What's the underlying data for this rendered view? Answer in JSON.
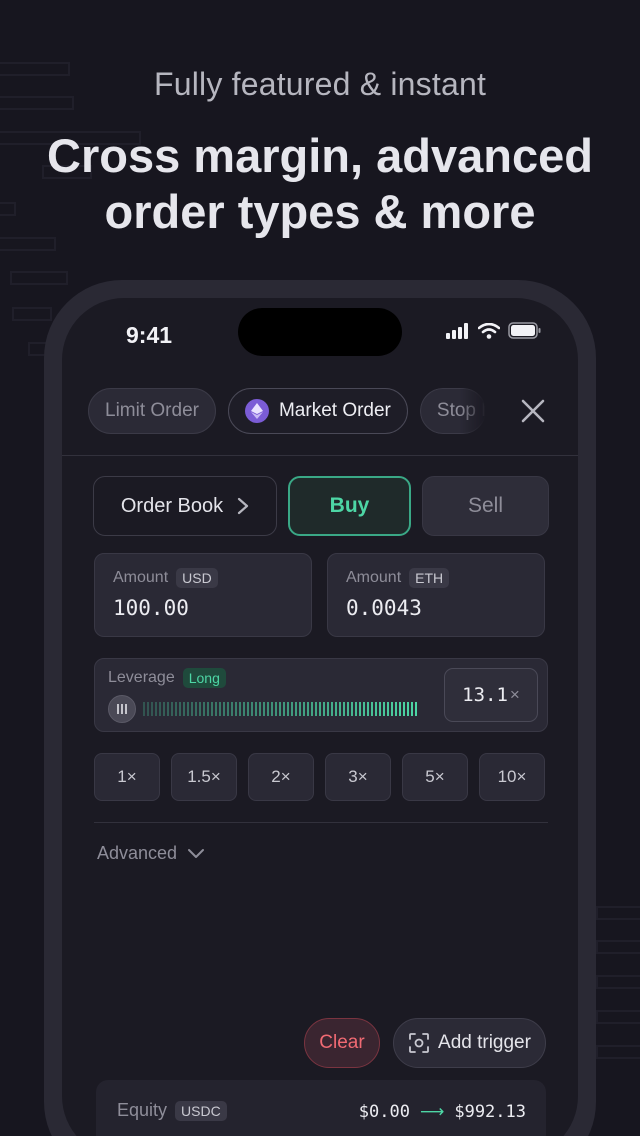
{
  "promo": {
    "tagline": "Fully featured & instant",
    "headline_line1": "Cross margin, advanced",
    "headline_line2": "order types & more"
  },
  "status_bar": {
    "time": "9:41"
  },
  "order_tabs": [
    {
      "label": "Limit Order",
      "active": false
    },
    {
      "label": "Market Order",
      "active": true,
      "icon": "ethereum-icon"
    },
    {
      "label": "Stop L",
      "active": false
    }
  ],
  "toolbar": {
    "order_book_label": "Order Book",
    "buy_label": "Buy",
    "sell_label": "Sell"
  },
  "amounts": [
    {
      "label": "Amount",
      "unit": "USD",
      "value": "100.00"
    },
    {
      "label": "Amount",
      "unit": "ETH",
      "value": "0.0043"
    }
  ],
  "leverage": {
    "label": "Leverage",
    "direction": "Long",
    "value": "13.1",
    "suffix": "×"
  },
  "presets": [
    "1×",
    "1.5×",
    "2×",
    "3×",
    "5×",
    "10×"
  ],
  "advanced_label": "Advanced",
  "actions": {
    "clear_label": "Clear",
    "add_trigger_label": "Add trigger"
  },
  "equity": {
    "label": "Equity",
    "unit": "USDC",
    "from": "$0.00",
    "to": "$992.13"
  },
  "colors": {
    "accent_green": "#4dd6a5",
    "danger_red": "#f06a73",
    "eth_purple": "#7b5cd6"
  }
}
